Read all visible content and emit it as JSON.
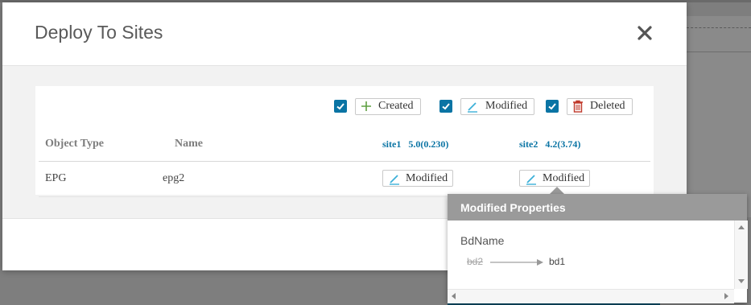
{
  "dialog": {
    "title": "Deploy To Sites"
  },
  "legend": {
    "created_label": "Created",
    "modified_label": "Modified",
    "deleted_label": "Deleted",
    "created_checked": true,
    "modified_checked": true,
    "deleted_checked": true
  },
  "table": {
    "columns": {
      "object_type": "Object Type",
      "name": "Name"
    },
    "sites": [
      {
        "name": "site1",
        "version": "5.0(0.230)"
      },
      {
        "name": "site2",
        "version": "4.2(3.74)"
      }
    ],
    "rows": [
      {
        "object_type": "EPG",
        "name": "epg2",
        "site_status": [
          "Modified",
          "Modified"
        ]
      }
    ]
  },
  "popover": {
    "title": "Modified Properties",
    "property_name": "BdName",
    "old_value": "bd2",
    "new_value": "bd1"
  },
  "colors": {
    "accent": "#0a74a4",
    "created_icon": "#5fa042",
    "modified_icon": "#3bb0d8",
    "deleted_icon": "#c0392b",
    "popover_header": "#9a9a9a"
  },
  "icons": {
    "close": "close-icon",
    "checkbox": "checkbox-checked-icon",
    "created": "plus-icon",
    "modified": "pencil-icon",
    "deleted": "trash-icon",
    "change_arrow": "arrow-right-icon"
  }
}
